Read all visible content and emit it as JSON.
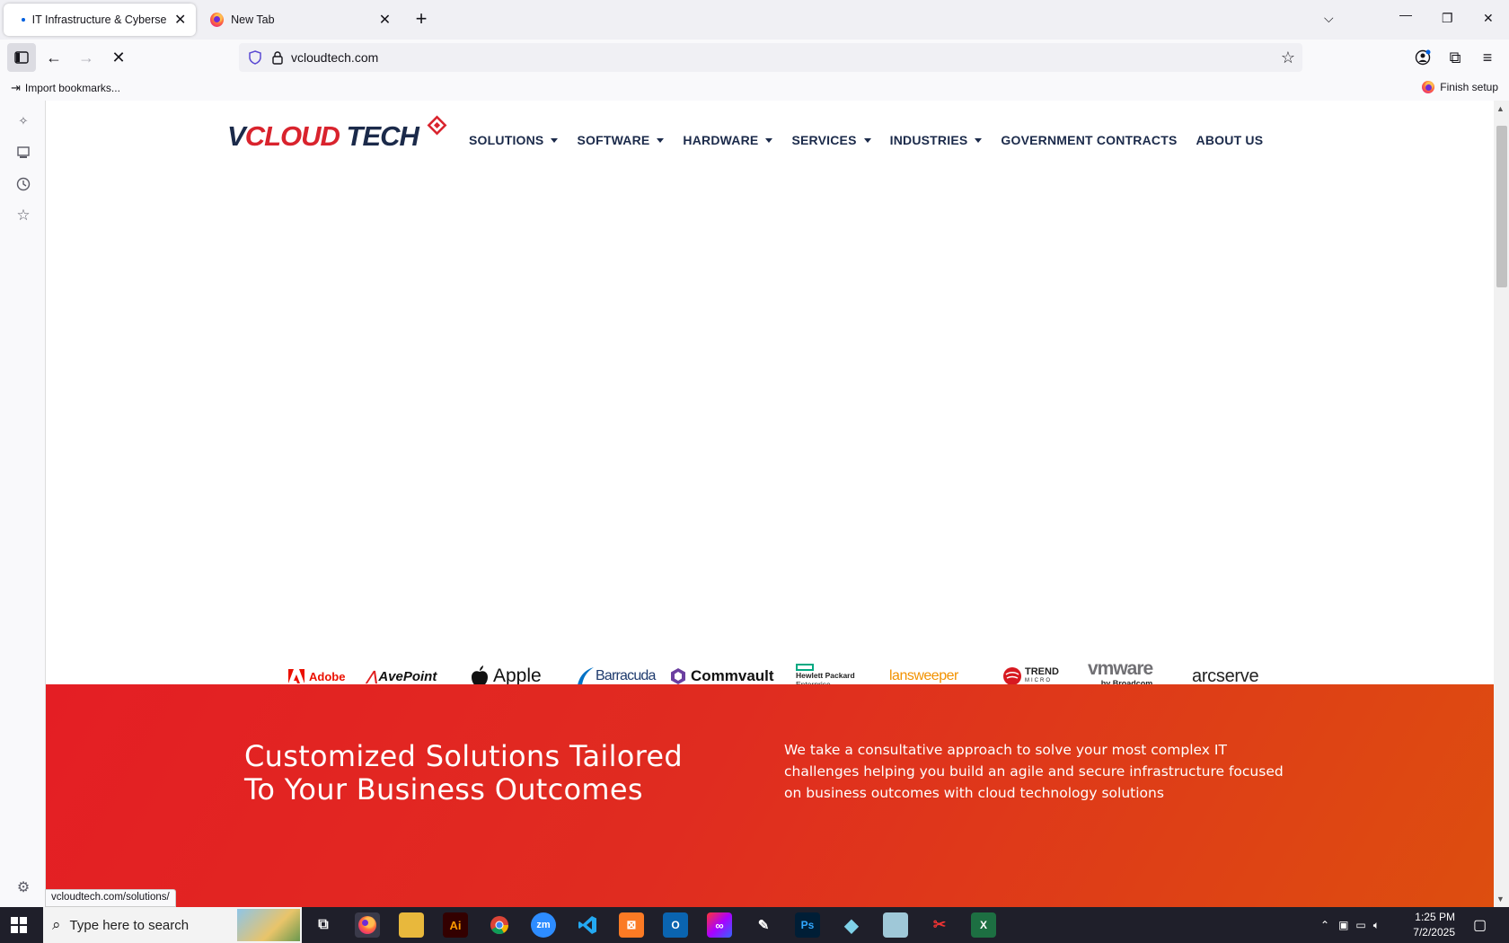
{
  "browser": {
    "tabs": [
      {
        "title": "IT Infrastructure & Cybersecurity",
        "active": true
      },
      {
        "title": "New Tab",
        "active": false
      }
    ],
    "url": "vcloudtech.com",
    "bookmarks_import": "Import bookmarks...",
    "finish_setup": "Finish setup",
    "status_url": "vcloudtech.com/solutions/"
  },
  "site": {
    "logo": {
      "v": "V",
      "cloud": "CLOUD",
      "tech": " TECH"
    },
    "menu": [
      {
        "label": "SOLUTIONS",
        "dropdown": true
      },
      {
        "label": "SOFTWARE",
        "dropdown": true
      },
      {
        "label": "HARDWARE",
        "dropdown": true
      },
      {
        "label": "SERVICES",
        "dropdown": true
      },
      {
        "label": "INDUSTRIES",
        "dropdown": true
      },
      {
        "label": "GOVERNMENT CONTRACTS",
        "dropdown": false
      },
      {
        "label": "ABOUT US",
        "dropdown": false
      }
    ],
    "brands": {
      "adobe": "Adobe",
      "avepoint": "AvePoint",
      "apple": "Apple",
      "barracuda": "Barracuda",
      "commvault": "Commvault",
      "hpe_line1": "Hewlett Packard",
      "hpe_line2": "Enterprise",
      "lansweeper": "lansweeper",
      "trend_line1": "TREND",
      "trend_line2": "MICRO",
      "vmware": "vmware",
      "vmware_sub": "by Broadcom",
      "arcserve": "arcserve"
    },
    "hero": {
      "heading": "Customized Solutions Tailored To Your Business Outcomes",
      "text": "We take a consultative approach to solve your most complex IT challenges helping you build an agile and secure infrastructure focused on business outcomes with cloud technology solutions"
    },
    "colors": {
      "navy": "#1b2a4a",
      "red": "#d9232d",
      "hero_start": "#e41e24",
      "hero_end": "#dd4e0f"
    }
  },
  "taskbar": {
    "search_placeholder": "Type here to search",
    "time": "1:25 PM",
    "date": "7/2/2025",
    "apps": [
      "firefox-icon",
      "file-explorer-icon",
      "illustrator-icon",
      "chrome-icon",
      "zoom-icon",
      "vscode-icon",
      "xampp-icon",
      "outlook-icon",
      "creative-cloud-icon",
      "pen-tool-icon",
      "photoshop-icon",
      "app-diamond-icon",
      "notes-icon",
      "snipping-tool-icon",
      "excel-icon"
    ],
    "labels": {
      "ai": "Ai",
      "zm": "zm",
      "ps": "Ps",
      "x": "X"
    }
  }
}
